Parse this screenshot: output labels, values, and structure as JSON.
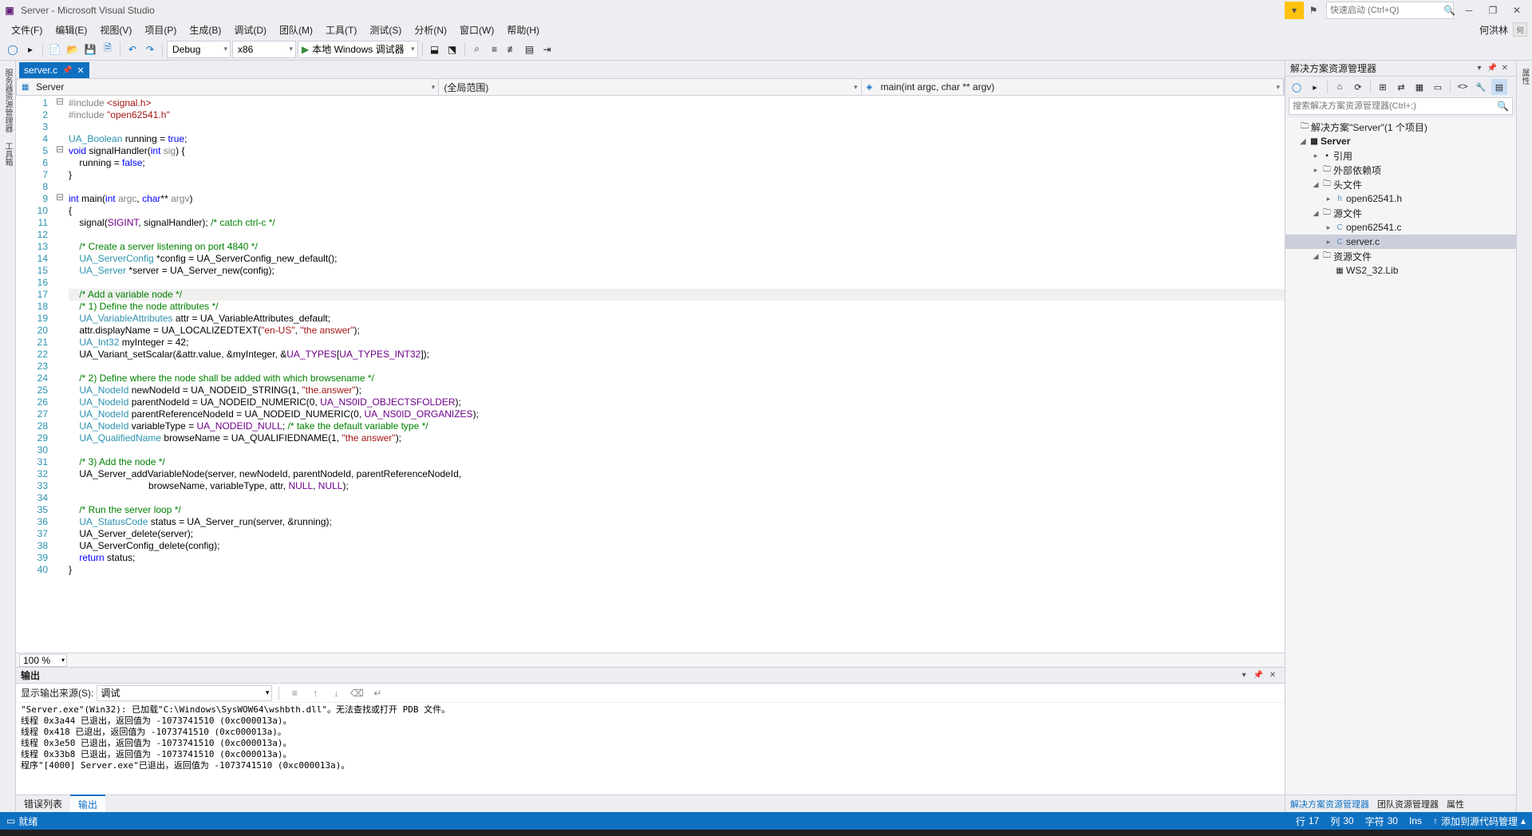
{
  "title": "Server - Microsoft Visual Studio",
  "quicklaunch_placeholder": "快速启动 (Ctrl+Q)",
  "user_name": "何洪林",
  "menu": [
    "文件(F)",
    "编辑(E)",
    "视图(V)",
    "项目(P)",
    "生成(B)",
    "调试(D)",
    "团队(M)",
    "工具(T)",
    "测试(S)",
    "分析(N)",
    "窗口(W)",
    "帮助(H)"
  ],
  "toolbar": {
    "config": "Debug",
    "platform": "x86",
    "run_label": "本地 Windows 调试器"
  },
  "left_tabs": [
    "服务器资源管理器",
    "工具箱"
  ],
  "right_tabs": [
    "属性"
  ],
  "doc_tab": {
    "name": "server.c"
  },
  "nav": {
    "project": "Server",
    "scope": "(全局范围)",
    "member": "main(int argc, char ** argv)"
  },
  "zoom": "100 %",
  "code": [
    {
      "n": 1,
      "fold": "⊟",
      "html": "<span class='inc'>#include </span><span class='str'>&lt;signal.h&gt;</span>"
    },
    {
      "n": 2,
      "fold": "",
      "html": "<span class='inc'>#include </span><span class='str'>\"open62541.h\"</span>"
    },
    {
      "n": 3,
      "fold": "",
      "html": ""
    },
    {
      "n": 4,
      "fold": "",
      "html": "<span class='type'>UA_Boolean</span> running = <span class='kw'>true</span>;"
    },
    {
      "n": 5,
      "fold": "⊟",
      "html": "<span class='kw'>void</span> signalHandler(<span class='kw'>int</span> <span class='inc'>sig</span>) {"
    },
    {
      "n": 6,
      "fold": "",
      "html": "    running = <span class='kw'>false</span>;"
    },
    {
      "n": 7,
      "fold": "",
      "html": "}"
    },
    {
      "n": 8,
      "fold": "",
      "html": ""
    },
    {
      "n": 9,
      "fold": "⊟",
      "html": "<span class='kw'>int</span> main(<span class='kw'>int</span> <span class='inc'>argc</span>, <span class='kw'>char</span>** <span class='inc'>argv</span>)"
    },
    {
      "n": 10,
      "fold": "",
      "html": "{"
    },
    {
      "n": 11,
      "fold": "",
      "html": "    signal(<span class='mac'>SIGINT</span>, signalHandler); <span class='com'>/* catch ctrl-c */</span>"
    },
    {
      "n": 12,
      "fold": "",
      "html": ""
    },
    {
      "n": 13,
      "fold": "",
      "html": "    <span class='com'>/* Create a server listening on port 4840 */</span>"
    },
    {
      "n": 14,
      "fold": "",
      "html": "    <span class='type'>UA_ServerConfig</span> *config = UA_ServerConfig_new_default();"
    },
    {
      "n": 15,
      "fold": "",
      "html": "    <span class='type'>UA_Server</span> *server = UA_Server_new(config);"
    },
    {
      "n": 16,
      "fold": "",
      "html": ""
    },
    {
      "n": 17,
      "fold": "",
      "hl": true,
      "html": "    <span class='com'>/* Add a variable node */</span>"
    },
    {
      "n": 18,
      "fold": "",
      "html": "    <span class='com'>/* 1) Define the node attributes */</span>"
    },
    {
      "n": 19,
      "fold": "",
      "html": "    <span class='type'>UA_VariableAttributes</span> attr = UA_VariableAttributes_default;"
    },
    {
      "n": 20,
      "fold": "",
      "html": "    attr.displayName = UA_LOCALIZEDTEXT(<span class='str'>\"en-US\"</span>, <span class='str'>\"the answer\"</span>);"
    },
    {
      "n": 21,
      "fold": "",
      "html": "    <span class='type'>UA_Int32</span> myInteger = 42;"
    },
    {
      "n": 22,
      "fold": "",
      "html": "    UA_Variant_setScalar(&attr.value, &myInteger, &<span class='mac'>UA_TYPES</span>[<span class='mac'>UA_TYPES_INT32</span>]);"
    },
    {
      "n": 23,
      "fold": "",
      "html": ""
    },
    {
      "n": 24,
      "fold": "",
      "html": "    <span class='com'>/* 2) Define where the node shall be added with which browsename */</span>"
    },
    {
      "n": 25,
      "fold": "",
      "html": "    <span class='type'>UA_NodeId</span> newNodeId = UA_NODEID_STRING(1, <span class='str'>\"the.answer\"</span>);"
    },
    {
      "n": 26,
      "fold": "",
      "html": "    <span class='type'>UA_NodeId</span> parentNodeId = UA_NODEID_NUMERIC(0, <span class='mac'>UA_NS0ID_OBJECTSFOLDER</span>);"
    },
    {
      "n": 27,
      "fold": "",
      "html": "    <span class='type'>UA_NodeId</span> parentReferenceNodeId = UA_NODEID_NUMERIC(0, <span class='mac'>UA_NS0ID_ORGANIZES</span>);"
    },
    {
      "n": 28,
      "fold": "",
      "html": "    <span class='type'>UA_NodeId</span> variableType = <span class='mac'>UA_NODEID_NULL</span>; <span class='com'>/* take the default variable type */</span>"
    },
    {
      "n": 29,
      "fold": "",
      "html": "    <span class='type'>UA_QualifiedName</span> browseName = UA_QUALIFIEDNAME(1, <span class='str'>\"the answer\"</span>);"
    },
    {
      "n": 30,
      "fold": "",
      "html": ""
    },
    {
      "n": 31,
      "fold": "",
      "html": "    <span class='com'>/* 3) Add the node */</span>"
    },
    {
      "n": 32,
      "fold": "",
      "html": "    UA_Server_addVariableNode(server, newNodeId, parentNodeId, parentReferenceNodeId,"
    },
    {
      "n": 33,
      "fold": "",
      "html": "                              browseName, variableType, attr, <span class='mac'>NULL</span>, <span class='mac'>NULL</span>);"
    },
    {
      "n": 34,
      "fold": "",
      "html": ""
    },
    {
      "n": 35,
      "fold": "",
      "html": "    <span class='com'>/* Run the server loop */</span>"
    },
    {
      "n": 36,
      "fold": "",
      "html": "    <span class='type'>UA_StatusCode</span> status = UA_Server_run(server, &running);"
    },
    {
      "n": 37,
      "fold": "",
      "html": "    UA_Server_delete(server);"
    },
    {
      "n": 38,
      "fold": "",
      "html": "    UA_ServerConfig_delete(config);"
    },
    {
      "n": 39,
      "fold": "",
      "html": "    <span class='kw'>return</span> status;"
    },
    {
      "n": 40,
      "fold": "",
      "html": "}"
    }
  ],
  "output": {
    "title": "输出",
    "source_label": "显示输出来源(S):",
    "source": "调试",
    "lines": [
      "\"Server.exe\"(Win32): 已加载\"C:\\Windows\\SysWOW64\\wshbth.dll\"。无法查找或打开 PDB 文件。",
      "线程 0x3a44 已退出，返回值为 -1073741510 (0xc000013a)。",
      "线程 0x418 已退出，返回值为 -1073741510 (0xc000013a)。",
      "线程 0x3e50 已退出，返回值为 -1073741510 (0xc000013a)。",
      "线程 0x33b8 已退出，返回值为 -1073741510 (0xc000013a)。",
      "程序\"[4000] Server.exe\"已退出，返回值为 -1073741510 (0xc000013a)。"
    ]
  },
  "bottom_tabs": {
    "error_list": "错误列表",
    "output": "输出"
  },
  "solution_explorer": {
    "title": "解决方案资源管理器",
    "search_placeholder": "搜索解决方案资源管理器(Ctrl+;)",
    "root": "解决方案\"Server\"(1 个项目)",
    "project": "Server",
    "refs": "引用",
    "external": "外部依赖项",
    "headers": "头文件",
    "header_items": [
      "open62541.h"
    ],
    "sources": "源文件",
    "source_items": [
      "open62541.c",
      "server.c"
    ],
    "resources": "资源文件",
    "resource_items": [
      "WS2_32.Lib"
    ],
    "links": {
      "se": "解决方案资源管理器",
      "team": "团队资源管理器",
      "props": "属性"
    }
  },
  "status": {
    "ready": "就绪",
    "line_lbl": "行",
    "line_val": "17",
    "col_lbl": "列",
    "col_val": "30",
    "char_lbl": "字符",
    "char_val": "30",
    "ins": "Ins",
    "add_src": "添加到源代码管理"
  }
}
